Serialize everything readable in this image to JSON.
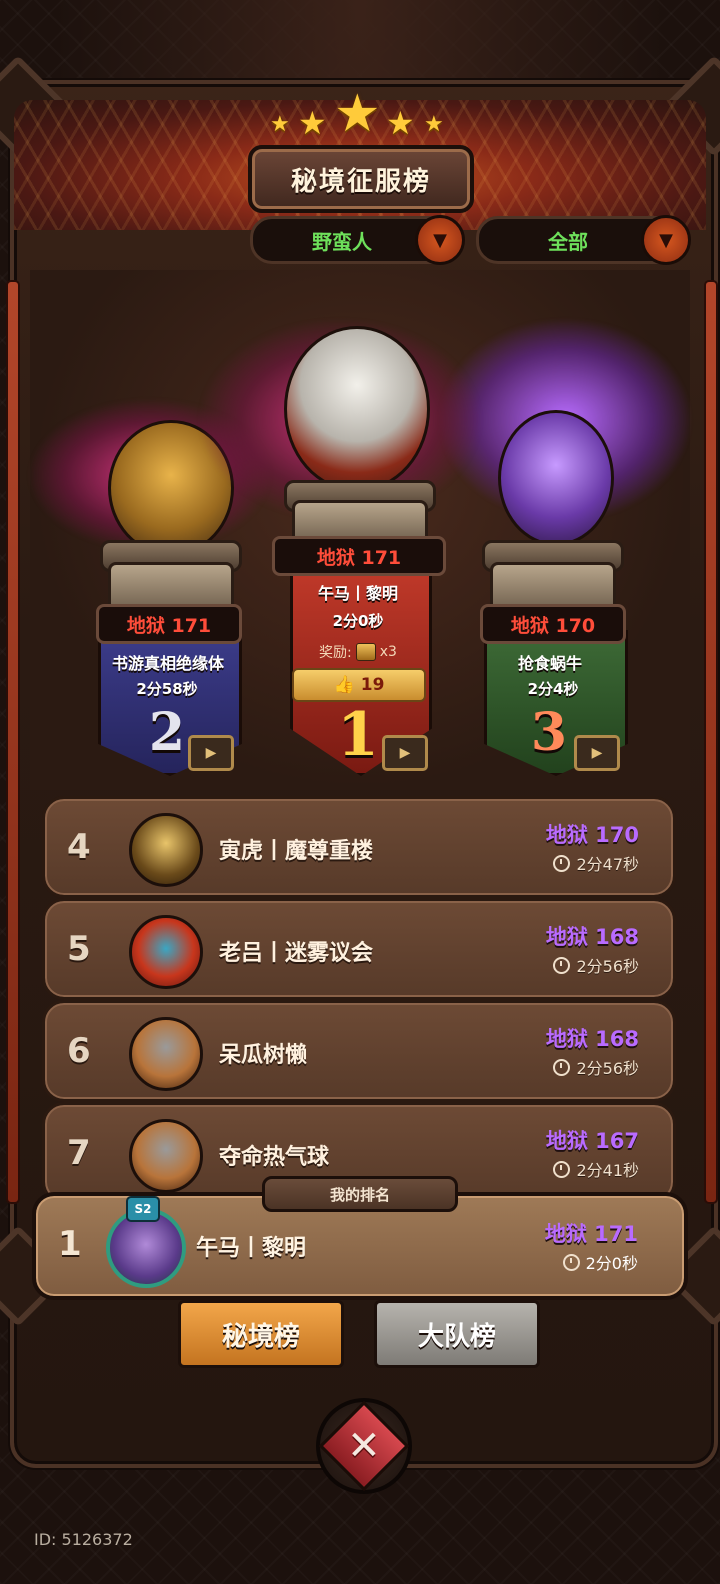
{
  "header": {
    "title": "秘境征服榜"
  },
  "filters": {
    "class_label": "野蛮人",
    "scope_label": "全部"
  },
  "podium": {
    "first": {
      "score_label": "地狱 171",
      "name": "午马丨黎明",
      "time": "2分0秒",
      "reward_label": "奖励:",
      "reward_count": "x3",
      "likes": "19",
      "rank": "1"
    },
    "second": {
      "score_label": "地狱 171",
      "name": "书游真相绝缘体",
      "time": "2分58秒",
      "rank": "2"
    },
    "third": {
      "score_label": "地狱 170",
      "name": "抢食蜗牛",
      "time": "2分4秒",
      "rank": "3"
    }
  },
  "list": [
    {
      "rank": "4",
      "name": "寅虎丨魔尊重楼",
      "score": "地狱 170",
      "time": "2分47秒"
    },
    {
      "rank": "5",
      "name": "老吕丨迷雾议会",
      "score": "地狱 168",
      "time": "2分56秒"
    },
    {
      "rank": "6",
      "name": "呆瓜树懒",
      "score": "地狱 168",
      "time": "2分56秒"
    },
    {
      "rank": "7",
      "name": "夺命热气球",
      "score": "地狱 167",
      "time": "2分41秒"
    }
  ],
  "my_rank": {
    "tag": "我的排名",
    "rank": "1",
    "badge": "S2",
    "name": "午马丨黎明",
    "score": "地狱 171",
    "time": "2分0秒"
  },
  "tabs": {
    "active": "秘境榜",
    "inactive": "大队榜"
  },
  "footer": {
    "id_text": "ID: 5126372"
  },
  "icons": {
    "dropdown": "chevron-down-icon",
    "video": "video-icon",
    "like": "thumbs-up-icon",
    "clock": "clock-icon",
    "close": "close-icon"
  },
  "colors": {
    "score_red": "#ff4d3a",
    "score_purple": "#b96bff",
    "class_green": "#6ee05b",
    "tab_active": "#e8963a"
  }
}
